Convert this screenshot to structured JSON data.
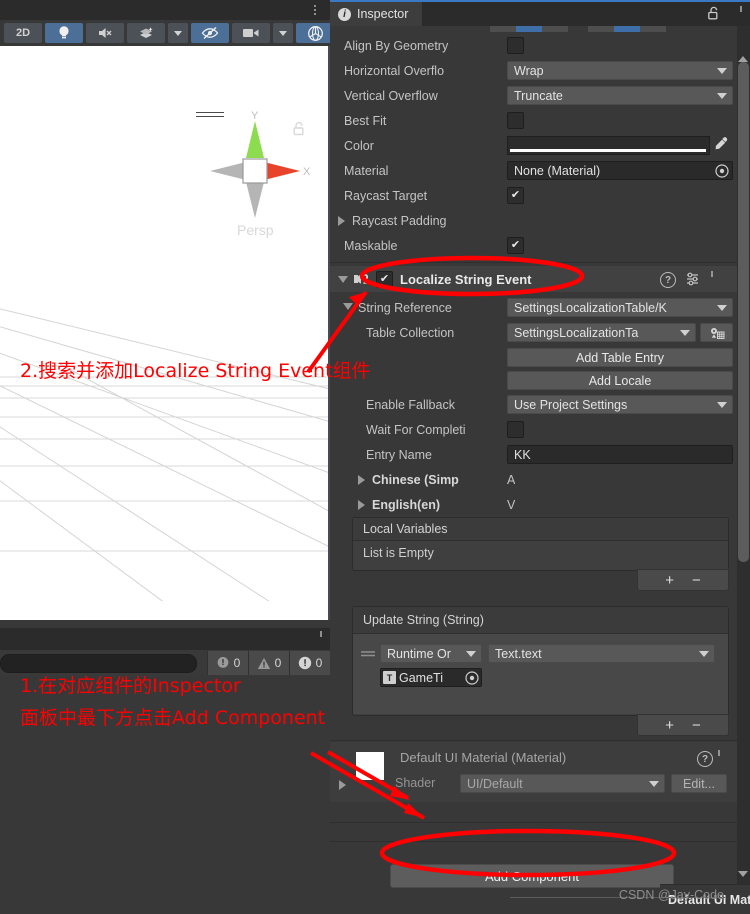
{
  "scene_panel": {
    "tab_menu_icon": "kebab-menu-icon",
    "toolbar": [
      {
        "label": "2D",
        "type": "text",
        "active": false
      },
      {
        "label": "",
        "type": "lighting-icon",
        "active": true
      },
      {
        "label": "",
        "type": "audio-mute-icon",
        "active": false
      },
      {
        "label": "",
        "type": "fx-icon",
        "active": false
      },
      {
        "label": "",
        "type": "chevron-down-icon",
        "active": false
      },
      {
        "label": "",
        "type": "hidden-objects-icon",
        "active": true
      },
      {
        "label": "",
        "type": "camera-icon",
        "active": false
      },
      {
        "label": "",
        "type": "chevron-down-icon",
        "active": false
      },
      {
        "label": "",
        "type": "gizmos-icon",
        "active": true
      },
      {
        "label": "",
        "type": "chevron-down-icon",
        "active": true
      }
    ],
    "gizmo": {
      "persp_label": "Persp",
      "axis_x": "X",
      "axis_y": "Y",
      "color_x": "#e8442c",
      "color_y": "#8ddb4f",
      "color_z": "#b5b5b5"
    }
  },
  "console_panel": {
    "tab_menu_icon": "kebab-menu-icon",
    "search_placeholder": "",
    "search_value": "",
    "counters": [
      {
        "icon": "log-icon",
        "count": "0"
      },
      {
        "icon": "warning-icon",
        "count": "0"
      },
      {
        "icon": "error-icon",
        "count": "0"
      }
    ]
  },
  "inspector": {
    "tab_label": "Inspector",
    "tab_icon": "info-icon",
    "lock_icon": "lock-open-icon",
    "menu_icon": "kebab-menu-icon",
    "scroll_up_icon": "scroll-up-arrow",
    "scroll_down_icon": "scroll-down-arrow",
    "text_component": {
      "rows": [
        {
          "label": "Align By Geometry",
          "type": "checkbox",
          "value": false
        },
        {
          "label": "Horizontal Overflo",
          "type": "dropdown",
          "value": "Wrap"
        },
        {
          "label": "Vertical Overflow",
          "type": "dropdown",
          "value": "Truncate"
        },
        {
          "label": "Best Fit",
          "type": "checkbox",
          "value": false
        },
        {
          "label": "Color",
          "type": "color",
          "value": "#ffffff"
        },
        {
          "label": "Material",
          "type": "object",
          "value": "None (Material)"
        },
        {
          "label": "Raycast Target",
          "type": "checkbox",
          "value": true
        },
        {
          "label": "Raycast Padding",
          "type": "foldout",
          "value": ""
        },
        {
          "label": "Maskable",
          "type": "checkbox",
          "value": true
        }
      ],
      "eyedropper_icon": "eyedropper-icon",
      "object_picker_icon": "object-picker-icon"
    },
    "localize_component": {
      "title": "Localize String Event",
      "enabled": true,
      "icon": "localization-script-icon",
      "help_icon": "help-icon",
      "preset_icon": "preset-icon",
      "menu_icon": "kebab-menu-icon",
      "rows": [
        {
          "label": "String Reference",
          "type": "dropdown",
          "value": "SettingsLocalizationTable/K"
        },
        {
          "label": "Table Collection",
          "type": "dropdown",
          "value": "SettingsLocalizationTa",
          "picker_icon": "table-picker-icon"
        },
        {
          "label": "",
          "type": "button",
          "value": "Add Table Entry"
        },
        {
          "label": "",
          "type": "button",
          "value": "Add Locale"
        },
        {
          "label": "Enable Fallback",
          "type": "dropdown",
          "value": "Use Project Settings"
        },
        {
          "label": "Wait For Completi",
          "type": "checkbox",
          "value": false
        },
        {
          "label": "Entry Name",
          "type": "textfield",
          "value": "KK"
        },
        {
          "label": "Chinese (Simp",
          "type": "foldout-value",
          "value": "A"
        },
        {
          "label": "English(en)",
          "type": "foldout-value",
          "value": "V"
        }
      ],
      "local_variables": {
        "header": "Local Variables",
        "empty_text": "List is Empty",
        "add_label": "+",
        "remove_label": "−"
      },
      "update_string": {
        "header": "Update String (String)",
        "call_mode": "Runtime Or",
        "target_function": "Text.text",
        "object_value": "GameTi",
        "object_icon": "text-component-icon",
        "object_picker_icon": "object-picker-icon",
        "drag_handle_icon": "drag-handle-icon",
        "add_label": "+",
        "remove_label": "−"
      }
    },
    "material_component": {
      "title": "Default UI Material (Material)",
      "help_icon": "help-icon",
      "menu_icon": "kebab-menu-icon",
      "swatch_color": "#ffffff",
      "shader_label": "Shader",
      "shader_value": "UI/Default",
      "edit_label": "Edit...",
      "foldout_icon": "foldout-arrow"
    },
    "add_component_button": "Add Component",
    "footer": {
      "label": "Default UI Material",
      "dropdown_icon": "chevron-down-icon",
      "menu_icon": "kebab-menu-icon"
    }
  },
  "annotations": {
    "note1_line1": "1.在对应组件的Inspector",
    "note1_line2": "面板中最下方点击Add Component",
    "note2": "2.搜索并添加Localize String Event组件",
    "color": "#ff0000"
  },
  "watermark": "CSDN @Jay-Code"
}
